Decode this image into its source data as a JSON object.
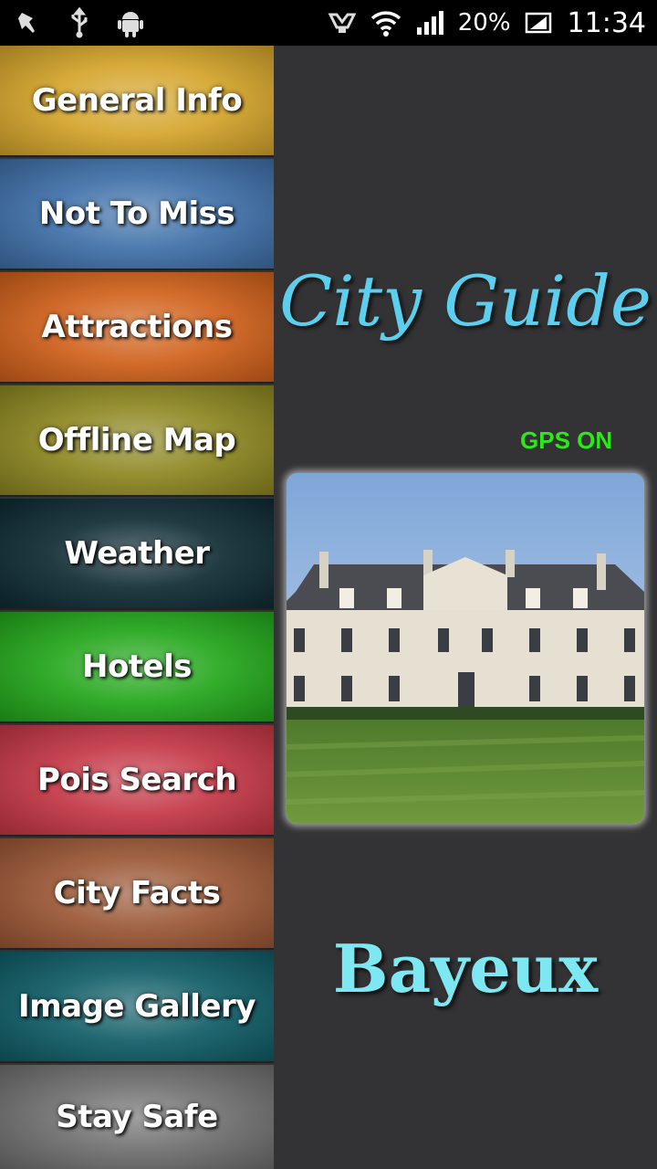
{
  "status_bar": {
    "left_icons": [
      "pin-icon",
      "usb-icon",
      "android-icon"
    ],
    "right_icons": [
      "headset-icon",
      "wifi-icon",
      "signal-icon",
      "battery-icon"
    ],
    "battery_text": "20%",
    "time": "11:34"
  },
  "menu": {
    "items": [
      {
        "label": "General Info",
        "color": "#d4a42a"
      },
      {
        "label": "Not To Miss",
        "color": "#3e6fa8"
      },
      {
        "label": "Attractions",
        "color": "#d0601a"
      },
      {
        "label": "Offline Map",
        "color": "#8c8620"
      },
      {
        "label": "Weather",
        "color": "#0e2a33"
      },
      {
        "label": "Hotels",
        "color": "#22a61a"
      },
      {
        "label": "Pois Search",
        "color": "#c43645"
      },
      {
        "label": "City Facts",
        "color": "#9a5634"
      },
      {
        "label": "Image Gallery",
        "color": "#0f5c66"
      },
      {
        "label": "Stay Safe",
        "color": "#6e6e6e"
      }
    ]
  },
  "main": {
    "title": "City Guide",
    "gps_status": "GPS ON",
    "city_name": "Bayeux"
  },
  "colors": {
    "background": "#333335",
    "title": "#5ccfee",
    "gps": "#2bea15",
    "city": "#7ee8f2"
  }
}
